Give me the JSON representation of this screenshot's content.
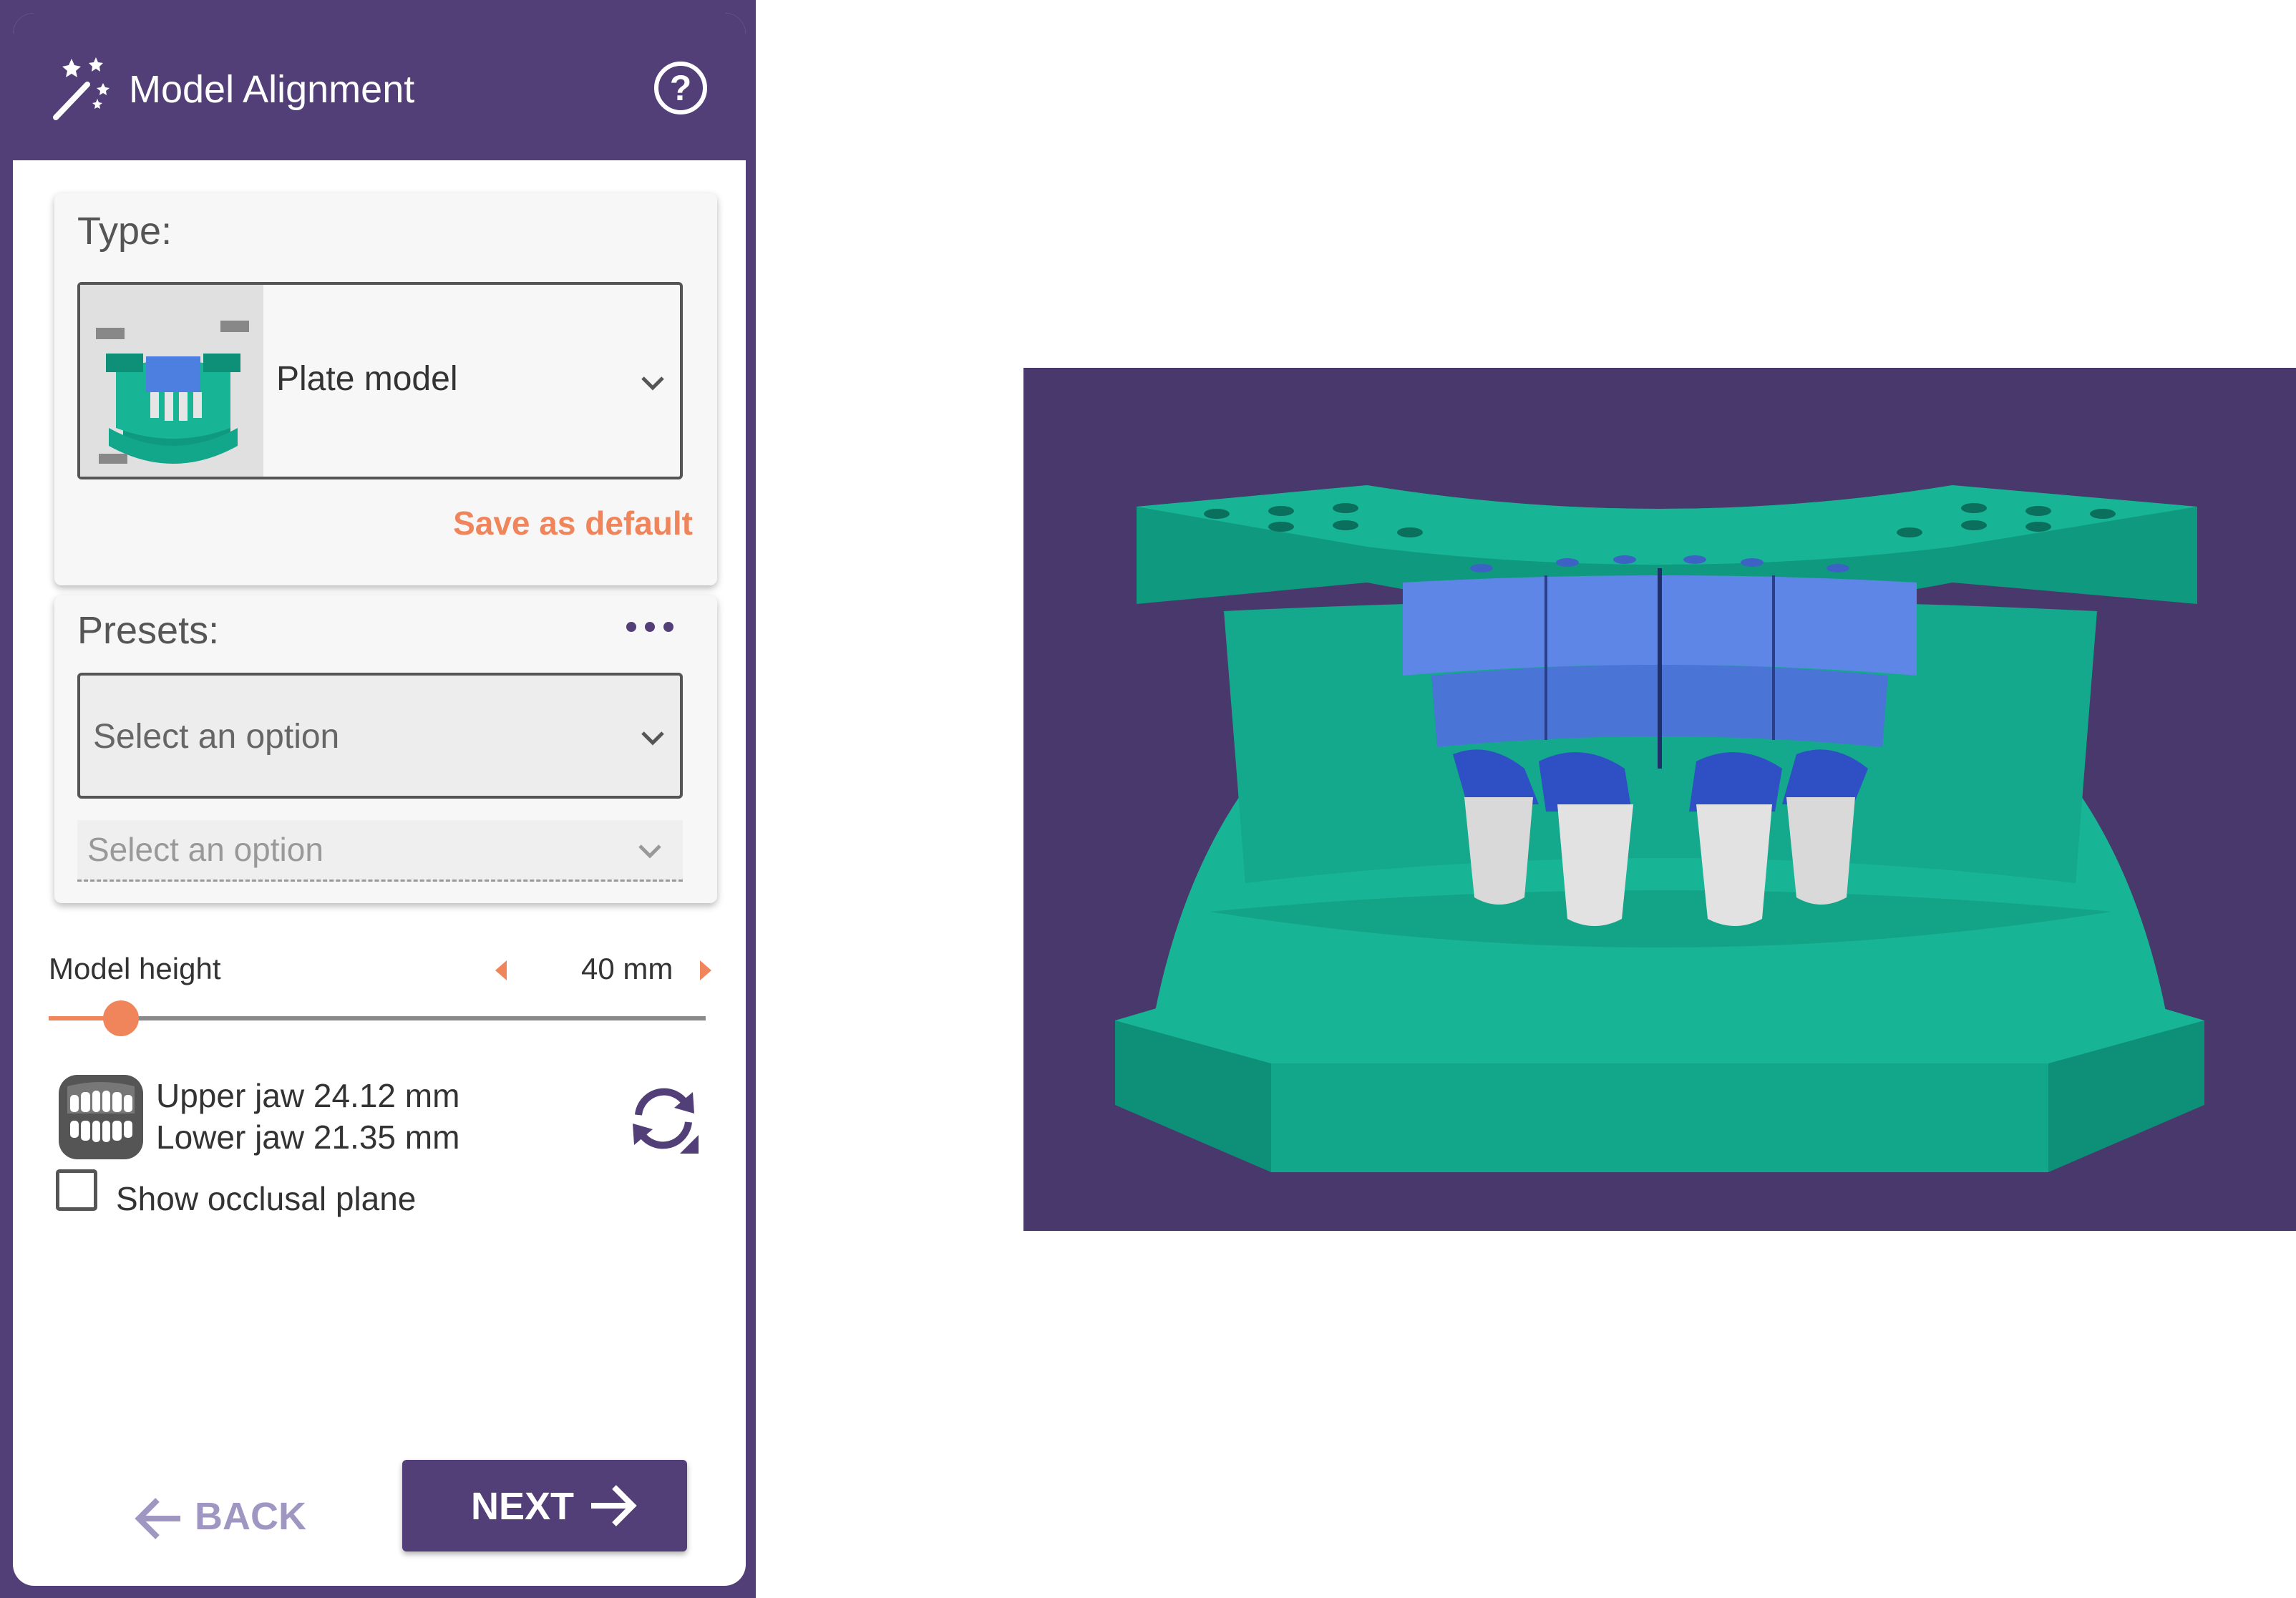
{
  "panel": {
    "title": "Model Alignment",
    "help_label": "?"
  },
  "type_section": {
    "label": "Type:",
    "selected": "Plate model",
    "save_default": "Save as default"
  },
  "presets_section": {
    "label": "Presets:",
    "select_primary_placeholder": "Select an option",
    "select_secondary_placeholder": "Select an option"
  },
  "model_height": {
    "label": "Model height",
    "value": "40 mm",
    "fraction": 0.11
  },
  "jaw_info": {
    "upper": "Upper jaw 24.12 mm",
    "lower": "Lower jaw 21.35 mm"
  },
  "occlusal": {
    "label": "Show occlusal plane",
    "checked": false
  },
  "nav": {
    "back": "BACK",
    "next": "NEXT"
  },
  "colors": {
    "brand_purple": "#523f78",
    "accent_orange": "#f0845a",
    "viewport_bg": "#48386c",
    "model_green": "#14a88c",
    "die_blue": "#5e86e6"
  },
  "icons": [
    "magic-wand-icon",
    "help-circle-icon",
    "chevron-down-icon",
    "more-dots-icon",
    "caret-left-icon",
    "caret-right-icon",
    "teeth-icon",
    "swap-jaws-icon",
    "arrow-left-icon",
    "arrow-right-icon"
  ]
}
